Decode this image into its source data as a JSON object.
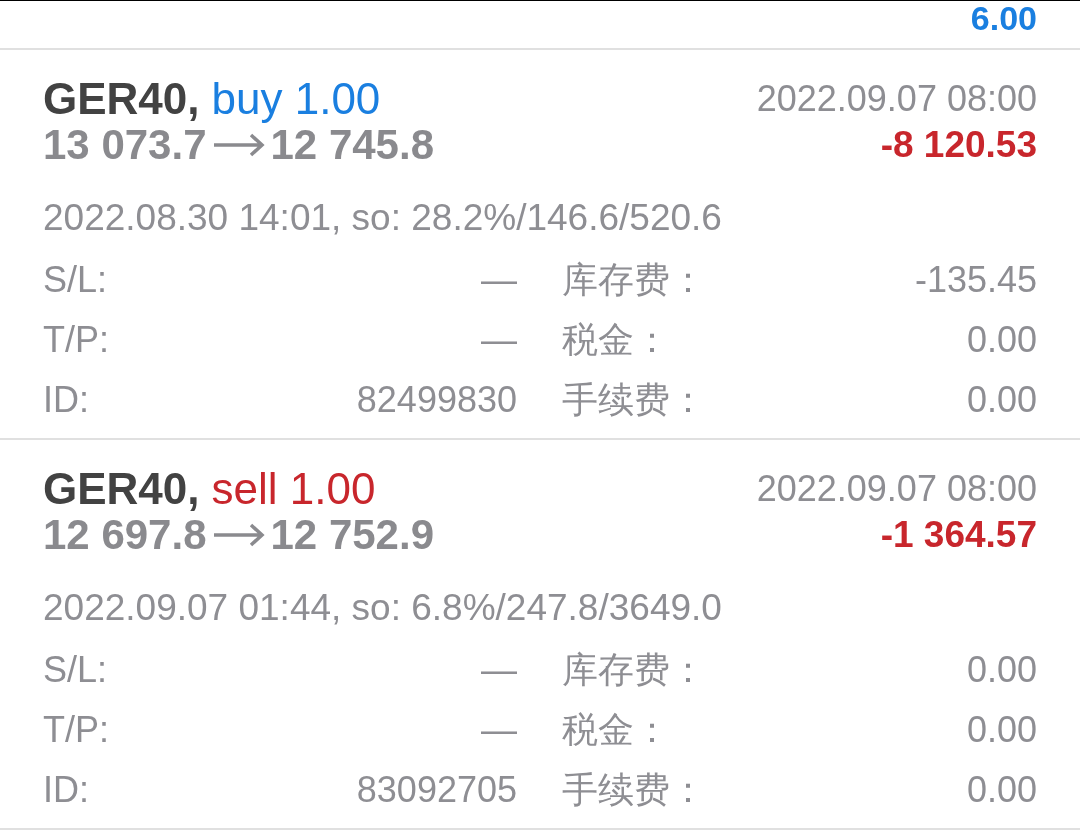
{
  "cut_off_trade": {
    "profit": "6.00",
    "loss": false
  },
  "trades": [
    {
      "kind": "buy",
      "symbol": "GER40,",
      "order": "buy 1.00",
      "open_price": "13 073.7",
      "close_price": "12 745.8",
      "close_time": "2022.09.07 08:00",
      "profit": "-8 120.53",
      "loss": true,
      "details": "2022.08.30 14:01, so: 28.2%/146.6/520.6",
      "fields": [
        {
          "label": "S/L:",
          "value": "—"
        },
        {
          "label": "库存费：",
          "value": "-135.45"
        },
        {
          "label": "T/P:",
          "value": "—"
        },
        {
          "label": "税金：",
          "value": "0.00"
        },
        {
          "label": "ID:",
          "value": "82499830"
        },
        {
          "label": "手续费：",
          "value": "0.00"
        }
      ]
    },
    {
      "kind": "sell",
      "symbol": "GER40,",
      "order": "sell 1.00",
      "open_price": "12 697.8",
      "close_price": "12 752.9",
      "close_time": "2022.09.07 08:00",
      "profit": "-1 364.57",
      "loss": true,
      "details": "2022.09.07 01:44, so: 6.8%/247.8/3649.0",
      "fields": [
        {
          "label": "S/L:",
          "value": "—"
        },
        {
          "label": "库存费：",
          "value": "0.00"
        },
        {
          "label": "T/P:",
          "value": "—"
        },
        {
          "label": "税金：",
          "value": "0.00"
        },
        {
          "label": "ID:",
          "value": "83092705"
        },
        {
          "label": "手续费：",
          "value": "0.00"
        }
      ]
    }
  ]
}
